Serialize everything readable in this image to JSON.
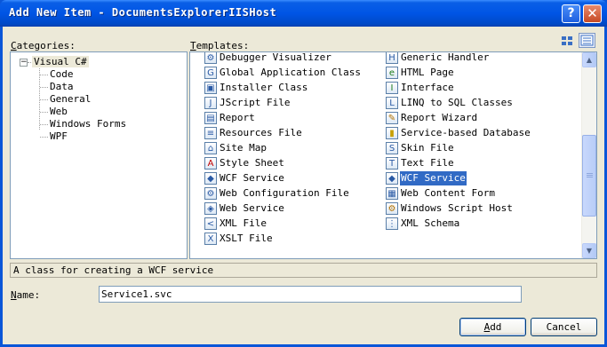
{
  "window": {
    "title": "Add New Item - DocumentsExplorerIISHost",
    "help_label": "?",
    "close_label": "✕"
  },
  "labels": {
    "categories_prefix": "C",
    "categories_rest": "ategories:",
    "templates_prefix": "T",
    "templates_rest": "emplates:",
    "name_prefix": "N",
    "name_rest": "ame:"
  },
  "categories": {
    "root": {
      "label": "Visual C#",
      "expander": "−"
    },
    "children": [
      {
        "label": "Code"
      },
      {
        "label": "Data"
      },
      {
        "label": "General"
      },
      {
        "label": "Web"
      },
      {
        "label": "Windows Forms"
      },
      {
        "label": "WPF"
      }
    ]
  },
  "templates": {
    "left_column": [
      {
        "label": "Debugger Visualizer",
        "icon": "debugger-icon"
      },
      {
        "label": "Global Application Class",
        "icon": "global-app-icon"
      },
      {
        "label": "Installer Class",
        "icon": "installer-icon"
      },
      {
        "label": "JScript File",
        "icon": "jscript-icon"
      },
      {
        "label": "Report",
        "icon": "report-icon"
      },
      {
        "label": "Resources File",
        "icon": "resources-icon"
      },
      {
        "label": "Site Map",
        "icon": "sitemap-icon"
      },
      {
        "label": "Style Sheet",
        "icon": "stylesheet-icon"
      },
      {
        "label": "WCF Service",
        "icon": "wcf-icon"
      },
      {
        "label": "Web Configuration File",
        "icon": "webconfig-icon"
      },
      {
        "label": "Web Service",
        "icon": "webservice-icon"
      },
      {
        "label": "XML File",
        "icon": "xml-icon"
      },
      {
        "label": "XSLT File",
        "icon": "xslt-icon"
      }
    ],
    "right_column": [
      {
        "label": "Generic Handler",
        "icon": "handler-icon"
      },
      {
        "label": "HTML Page",
        "icon": "html-icon"
      },
      {
        "label": "Interface",
        "icon": "interface-icon"
      },
      {
        "label": "LINQ to SQL Classes",
        "icon": "linq-icon"
      },
      {
        "label": "Report Wizard",
        "icon": "report-wizard-icon"
      },
      {
        "label": "Service-based Database",
        "icon": "database-icon"
      },
      {
        "label": "Skin File",
        "icon": "skin-icon"
      },
      {
        "label": "Text File",
        "icon": "text-icon"
      },
      {
        "label": "WCF Service",
        "icon": "wcf-icon",
        "selected": true
      },
      {
        "label": "Web Content Form",
        "icon": "content-form-icon"
      },
      {
        "label": "Windows Script Host",
        "icon": "script-host-icon"
      },
      {
        "label": "XML Schema",
        "icon": "schema-icon"
      }
    ]
  },
  "description": "A class for creating a WCF service",
  "name_field": {
    "value": "Service1.svc"
  },
  "buttons": {
    "add_prefix": "A",
    "add_rest": "dd",
    "cancel": "Cancel"
  },
  "scrollbar": {
    "up": "▲",
    "down": "▼"
  },
  "colors": {
    "title_bar": "#0055e5",
    "selection": "#316ac5",
    "dialog_bg": "#ece9d8"
  }
}
